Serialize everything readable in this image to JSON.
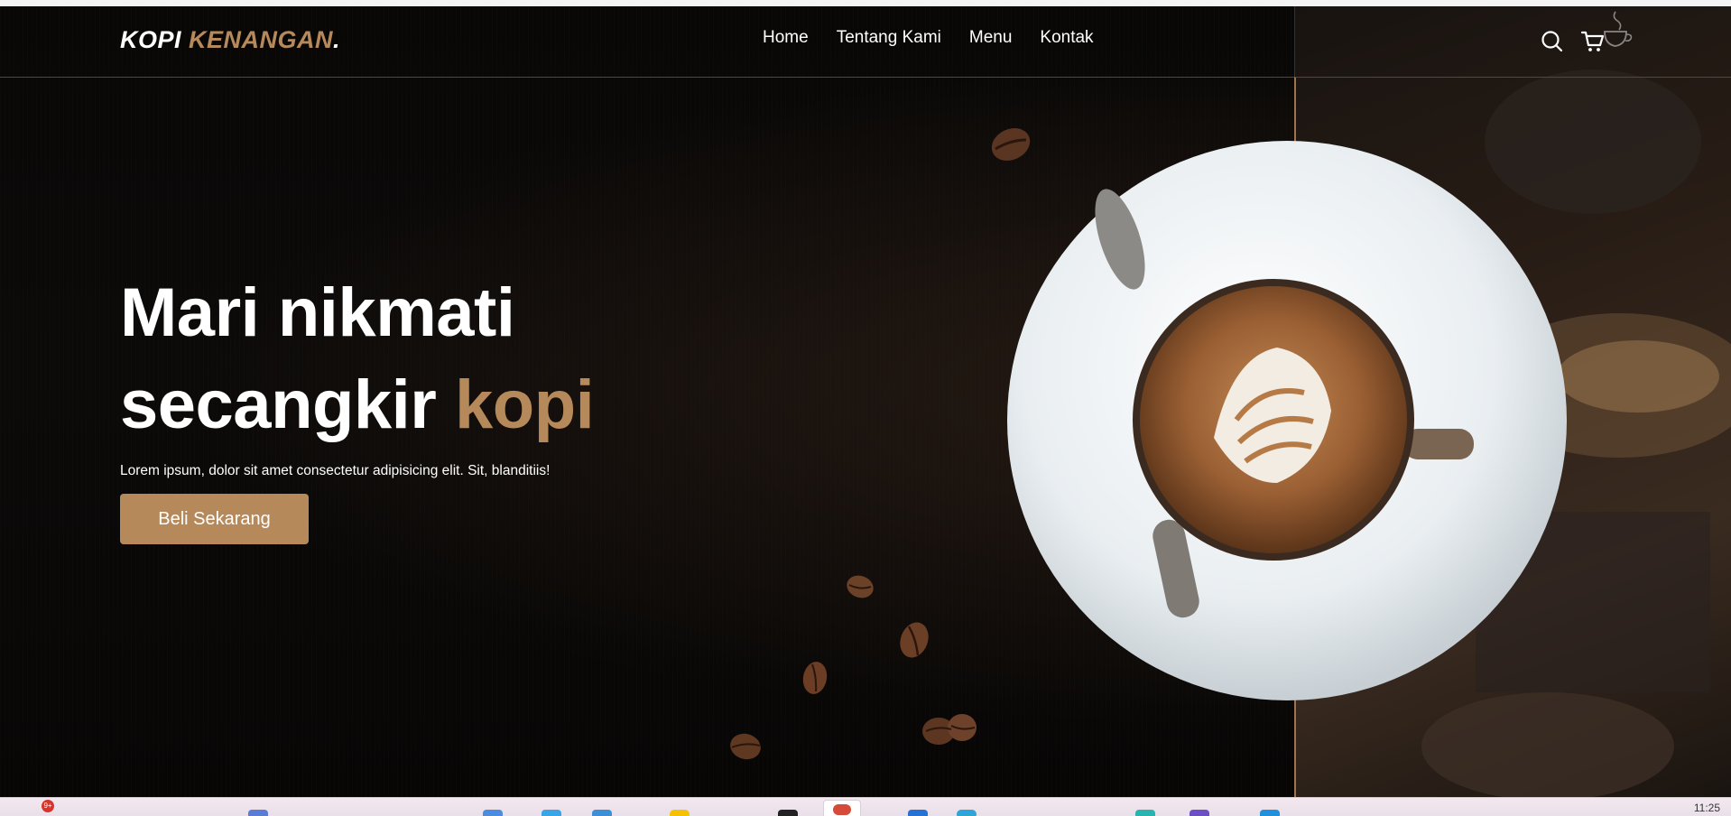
{
  "brand": {
    "name_primary": "KOPI",
    "name_accent": "KENANGAN",
    "name_dot": ".",
    "accent_color": "#b6895b"
  },
  "nav": {
    "items": [
      {
        "label": "Home"
      },
      {
        "label": "Tentang Kami"
      },
      {
        "label": "Menu"
      },
      {
        "label": "Kontak"
      }
    ],
    "icons": {
      "search": "search-icon",
      "cart": "cart-icon",
      "coffee_cup": "coffee-cup-icon"
    }
  },
  "hero": {
    "headline_line1": "Mari nikmati",
    "headline_line2_prefix": "secangkir ",
    "headline_line2_accent": "kopi",
    "subtitle": "Lorem ipsum, dolor sit amet consectetur adipisicing elit. Sit, blanditiis!",
    "cta_label": "Beli Sekarang"
  },
  "taskbar": {
    "clock": "11:25",
    "notification_badge": "9+"
  }
}
